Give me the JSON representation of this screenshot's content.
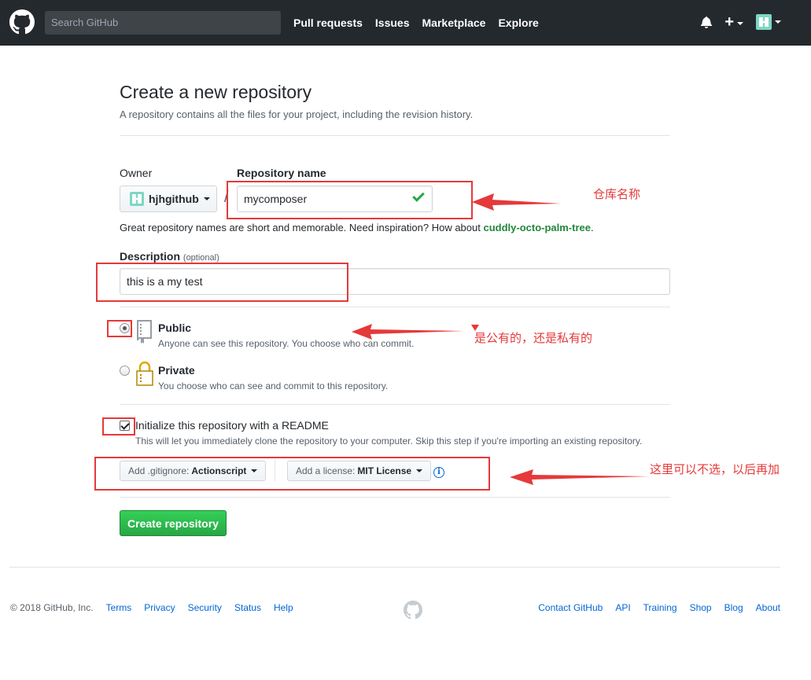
{
  "header": {
    "search_placeholder": "Search GitHub",
    "nav": [
      "Pull requests",
      "Issues",
      "Marketplace",
      "Explore"
    ],
    "plus": "+"
  },
  "page": {
    "title": "Create a new repository",
    "subtitle": "A repository contains all the files for your project, including the revision history."
  },
  "owner": {
    "label": "Owner",
    "value": "hjhgithub"
  },
  "repo": {
    "label": "Repository name",
    "value": "mycomposer",
    "slash": "/"
  },
  "hint": {
    "text": "Great repository names are short and memorable. Need inspiration? How about ",
    "suggestion": "cuddly-octo-palm-tree",
    "end": "."
  },
  "description": {
    "label": "Description",
    "optional": "(optional)",
    "value": "this is a my test"
  },
  "visibility": {
    "selected": "public",
    "public": {
      "title": "Public",
      "desc": "Anyone can see this repository. You choose who can commit."
    },
    "private": {
      "title": "Private",
      "desc": "You choose who can see and commit to this repository."
    }
  },
  "readme": {
    "checked": true,
    "title": "Initialize this repository with a README",
    "desc": "This will let you immediately clone the repository to your computer. Skip this step if you're importing an existing repository."
  },
  "gitignore": {
    "prefix": "Add .gitignore:",
    "value": "Actionscript"
  },
  "license": {
    "prefix": "Add a license:",
    "value": "MIT License"
  },
  "info_glyph": "i",
  "create_button": "Create repository",
  "annotations": {
    "repo_name": "仓库名称",
    "visibility": "是公有的，还是私有的",
    "optional": "这里可以不选，以后再加",
    "color": "#e5393a"
  },
  "footer": {
    "copyright": "© 2018 GitHub, Inc.",
    "left_links": [
      "Terms",
      "Privacy",
      "Security",
      "Status",
      "Help"
    ],
    "right_links": [
      "Contact GitHub",
      "API",
      "Training",
      "Shop",
      "Blog",
      "About"
    ]
  }
}
